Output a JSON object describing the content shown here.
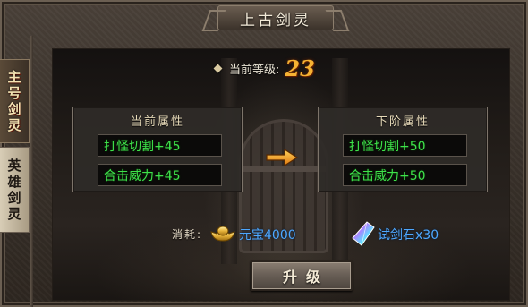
{
  "window": {
    "title": "上古剑灵"
  },
  "side_tabs": [
    {
      "label": [
        "主",
        "号",
        "剑",
        "灵"
      ],
      "active": true
    },
    {
      "label": [
        "英",
        "雄",
        "剑",
        "灵"
      ],
      "active": false
    }
  ],
  "level": {
    "label": "当前等级:",
    "value": "23"
  },
  "current_attrs": {
    "title": "当前属性",
    "stats": [
      "打怪切割+45",
      "合击威力+45"
    ]
  },
  "next_attrs": {
    "title": "下阶属性",
    "stats": [
      "打怪切割+50",
      "合击威力+50"
    ]
  },
  "cost": {
    "label": "消耗:",
    "gold": "元宝4000",
    "stone": "试剑石x30"
  },
  "upgrade_button": {
    "label": "升级"
  },
  "colors": {
    "stat_green": "#3ee24a",
    "cost_blue": "#4ea8ff",
    "level_orange": "#f6b233"
  }
}
